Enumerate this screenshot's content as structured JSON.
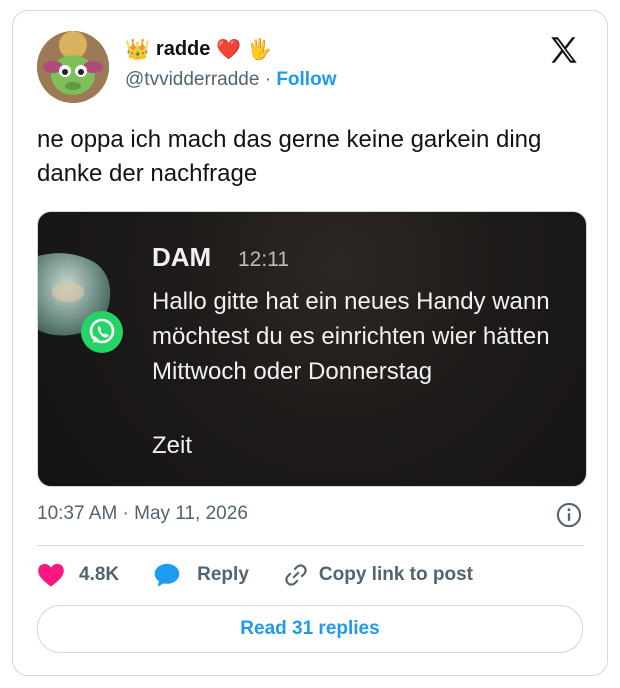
{
  "author": {
    "display_name": "radde",
    "emoji_prefix": "👑",
    "emoji_suffix_heart": "❤️",
    "emoji_suffix_hand": "🖐",
    "handle": "@tvvidderradde",
    "separator": "·",
    "follow_label": "Follow"
  },
  "tweet": {
    "text": "ne oppa ich mach das gerne keine garkein ding danke der nachfrage"
  },
  "media": {
    "notification": {
      "sender": "DAM",
      "time": "12:11",
      "message": "Hallo  gitte hat ein neues Handy wann möchtest du es einrichten wier hätten Mittwoch oder Donnerstag",
      "extra": "Zeit"
    }
  },
  "meta": {
    "timestamp": "10:37 AM · May 11, 2026"
  },
  "actions": {
    "likes": "4.8K",
    "reply_label": "Reply",
    "copy_link_label": "Copy link to post"
  },
  "read_replies_label": "Read 31 replies",
  "colors": {
    "accent": "#1d9bf0",
    "heart": "#f91880",
    "text_secondary": "#536471",
    "border": "#cfd9de",
    "whatsapp": "#25d366"
  }
}
